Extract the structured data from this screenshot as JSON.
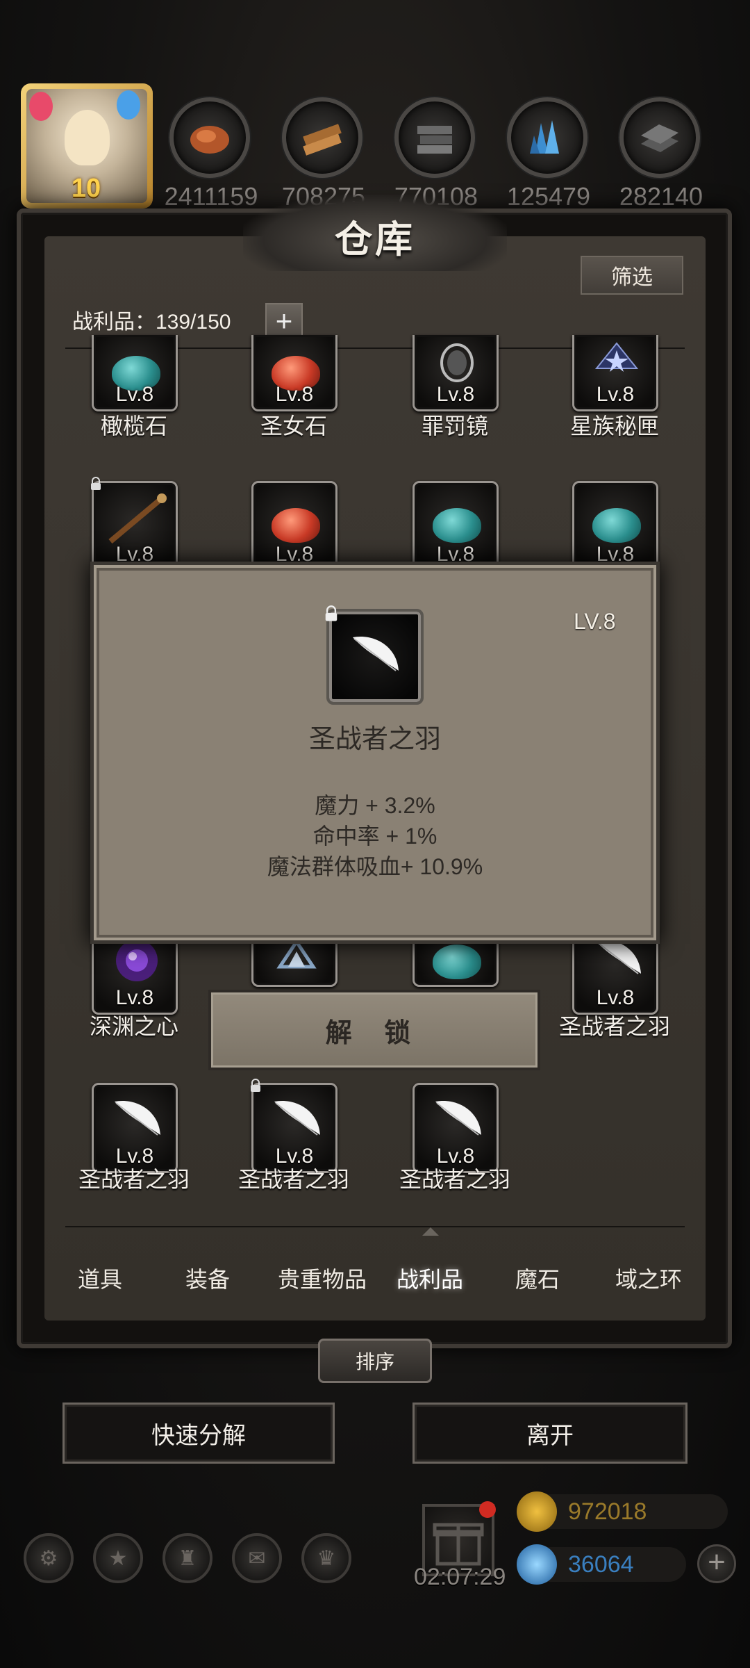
{
  "resources": {
    "avatar_level": "10",
    "items": [
      {
        "icon": "leather-icon",
        "value": "2411159"
      },
      {
        "icon": "wood-icon",
        "value": "708275"
      },
      {
        "icon": "stone-icon",
        "value": "770108"
      },
      {
        "icon": "crystal-icon",
        "value": "125479"
      },
      {
        "icon": "iron-icon",
        "value": "282140"
      }
    ]
  },
  "warehouse": {
    "title": "仓库",
    "filter_label": "筛选",
    "loot_count": "战利品：139/150",
    "plus_label": "+"
  },
  "grid": {
    "row1": [
      {
        "name": "橄榄石",
        "lv": "Lv.8",
        "icon": "teal-gem-icon"
      },
      {
        "name": "圣女石",
        "lv": "Lv.8",
        "icon": "red-gem-icon"
      },
      {
        "name": "罪罚镜",
        "lv": "Lv.8",
        "icon": "mirror-icon"
      },
      {
        "name": "星族秘匣",
        "lv": "Lv.8",
        "icon": "star-box-icon"
      }
    ],
    "row2": [
      {
        "lv": "Lv.8",
        "icon": "staff-icon"
      },
      {
        "lv": "Lv.8",
        "icon": "red-gem-icon"
      },
      {
        "lv": "Lv.8",
        "icon": "teal-gem-icon"
      },
      {
        "lv": "Lv.8",
        "icon": "teal-gem-icon"
      }
    ],
    "row3": [
      {
        "name": "深渊之心",
        "lv": "Lv.8",
        "icon": "abyss-heart-icon"
      },
      {
        "name": "",
        "lv": "",
        "icon": "crest-icon"
      },
      {
        "name": "",
        "lv": "",
        "icon": "teal-gem-icon"
      },
      {
        "name": "圣战者之羽",
        "lv": "Lv.8",
        "icon": "feather-icon"
      }
    ],
    "row4": [
      {
        "name": "圣战者之羽",
        "lv": "Lv.8",
        "icon": "feather-icon"
      },
      {
        "name": "圣战者之羽",
        "lv": "Lv.8",
        "icon": "feather-icon"
      },
      {
        "name": "圣战者之羽",
        "lv": "Lv.8",
        "icon": "feather-icon"
      }
    ]
  },
  "popup": {
    "level": "LV.8",
    "name": "圣战者之羽",
    "stats": [
      "魔力 + 3.2%",
      "命中率 + 1%",
      "魔法群体吸血+ 10.9%"
    ],
    "unlock_label": "解 锁"
  },
  "tabs": [
    {
      "label": "道具",
      "active": false
    },
    {
      "label": "装备",
      "active": false
    },
    {
      "label": "贵重物品",
      "active": false
    },
    {
      "label": "战利品",
      "active": true
    },
    {
      "label": "魔石",
      "active": false
    },
    {
      "label": "域之环",
      "active": false
    }
  ],
  "sort_label": "排序",
  "actions": {
    "quick_decompose": "快速分解",
    "leave": "离开"
  },
  "bottom": {
    "timer": "02:07:29",
    "gold": "972018",
    "gems": "36064"
  },
  "colors": {
    "panel_bg": "#3a352f",
    "popup_bg": "#8a8174",
    "gold_text": "#9a7a2a",
    "gem_text": "#3a7fbf"
  }
}
